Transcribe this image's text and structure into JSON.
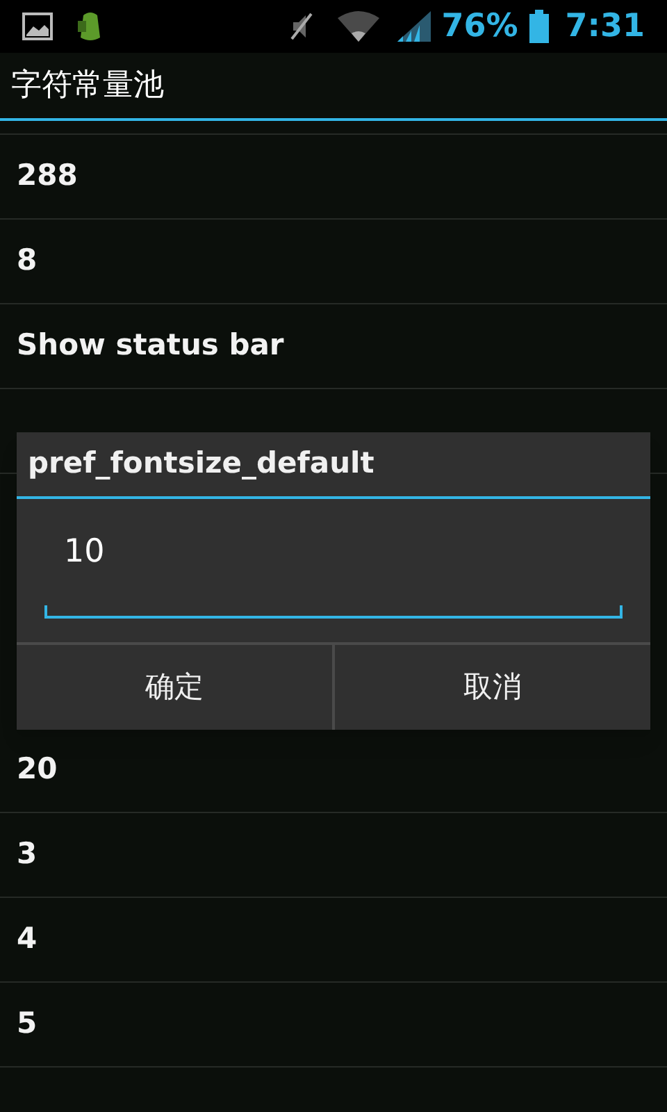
{
  "status_bar": {
    "battery_percent": "76%",
    "time": "7:31"
  },
  "action_bar": {
    "title": "字符常量池"
  },
  "list": {
    "items_above": [
      "288",
      "8",
      "Show status bar"
    ],
    "items_below": [
      "20",
      "3",
      "4",
      "5"
    ]
  },
  "dialog": {
    "title": "pref_fontsize_default",
    "input": {
      "value": "10"
    },
    "buttons": [
      "确定",
      "取消"
    ]
  }
}
